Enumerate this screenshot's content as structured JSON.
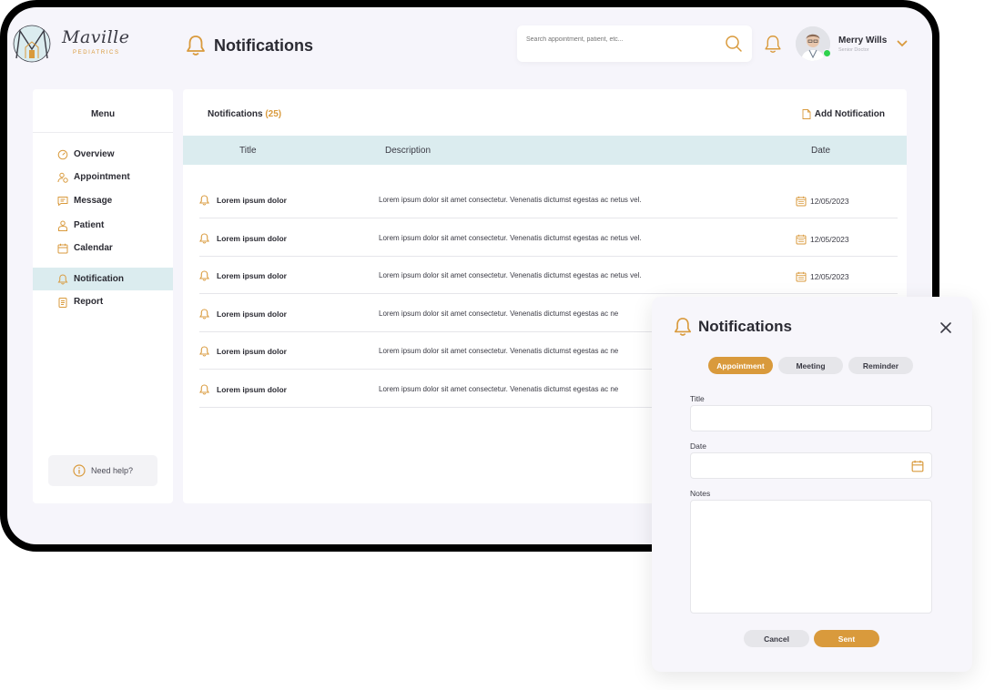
{
  "brand": {
    "name": "Maville",
    "subtitle": "PEDIATRICS",
    "accent": "#d99a3c",
    "highlight": "#dbecef"
  },
  "header": {
    "title": "Notifications",
    "search_placeholder": "Search appointment, patient, etc...",
    "user": {
      "name": "Merry Wills",
      "role": "Senior Doctor",
      "status": "online"
    }
  },
  "sidebar": {
    "title": "Menu",
    "items": [
      {
        "label": "Overview",
        "icon": "gauge-icon"
      },
      {
        "label": "Appointment",
        "icon": "user-clock-icon"
      },
      {
        "label": "Message",
        "icon": "chat-icon"
      },
      {
        "label": "Patient",
        "icon": "patient-icon"
      },
      {
        "label": "Calendar",
        "icon": "calendar-icon"
      },
      {
        "label": "Notification",
        "icon": "bell-icon",
        "active": true
      },
      {
        "label": "Report",
        "icon": "clipboard-icon"
      }
    ],
    "help_label": "Need help?"
  },
  "main": {
    "title": "Notifications",
    "count": "(25)",
    "add_label": "Add Notification",
    "columns": {
      "title": "Title",
      "description": "Description",
      "date": "Date"
    },
    "rows": [
      {
        "title": "Lorem ipsum dolor",
        "description": "Lorem ipsum dolor sit amet consectetur. Venenatis dictumst egestas ac netus vel.",
        "date": "12/05/2023"
      },
      {
        "title": "Lorem ipsum dolor",
        "description": "Lorem ipsum dolor sit amet consectetur. Venenatis dictumst egestas ac netus vel.",
        "date": "12/05/2023"
      },
      {
        "title": "Lorem ipsum dolor",
        "description": "Lorem ipsum dolor sit amet consectetur. Venenatis dictumst egestas ac netus vel.",
        "date": "12/05/2023"
      },
      {
        "title": "Lorem ipsum dolor",
        "description": "Lorem ipsum dolor sit amet consectetur. Venenatis dictumst egestas ac ne",
        "date": ""
      },
      {
        "title": "Lorem ipsum dolor",
        "description": "Lorem ipsum dolor sit amet consectetur. Venenatis dictumst egestas ac ne",
        "date": ""
      },
      {
        "title": "Lorem ipsum dolor",
        "description": "Lorem ipsum dolor sit amet consectetur. Venenatis dictumst egestas ac ne",
        "date": ""
      }
    ]
  },
  "modal": {
    "title": "Notifications",
    "tabs": [
      "Appointment",
      "Meeting",
      "Reminder"
    ],
    "active_tab": "Appointment",
    "fields": {
      "title_label": "Title",
      "title_value": "",
      "date_label": "Date",
      "date_value": "",
      "notes_label": "Notes",
      "notes_value": ""
    },
    "cancel_label": "Cancel",
    "sent_label": "Sent"
  }
}
